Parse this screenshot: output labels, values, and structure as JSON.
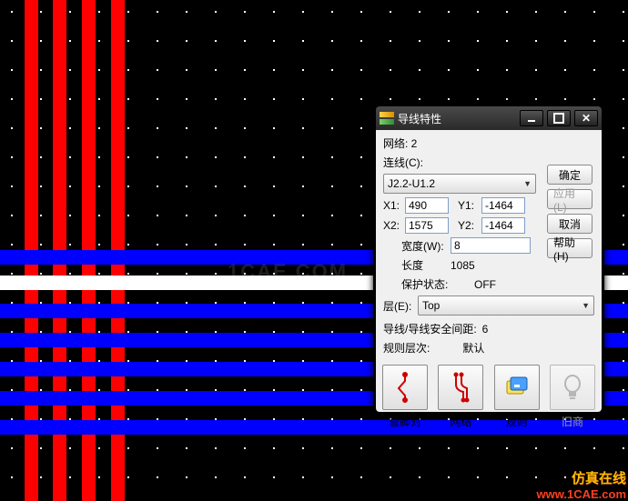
{
  "dialog": {
    "title": "导线特性",
    "net_label_line": "网络: 2",
    "conn_label": "连线(C):",
    "conn_value": "J2.2-U1.2",
    "x1_label": "X1:",
    "x1_value": "490",
    "y1_label": "Y1:",
    "y1_value": "-1464",
    "x2_label": "X2:",
    "x2_value": "1575",
    "y2_label": "Y2:",
    "y2_value": "-1464",
    "width_label": "宽度(W):",
    "width_value": "8",
    "length_label": "长度",
    "length_value": "1085",
    "protect_label": "保护状态:",
    "protect_value": "OFF",
    "layer_label": "层(E):",
    "layer_value": "Top",
    "clearance_label": "导线/导线安全间距:",
    "clearance_value": "6",
    "rlevel_label": "规则层次:",
    "rlevel_value": "默认",
    "icons": {
      "pinpair": "管脚对",
      "net": "网络",
      "rules": "规则",
      "show": "旧商"
    },
    "buttons": {
      "ok": "确定",
      "apply": "应用(L)",
      "cancel": "取消",
      "help": "帮助(H)"
    }
  },
  "watermark": {
    "main": "1CAE.COM",
    "badge_top": "仿真在线",
    "badge_bottom": "www.1CAE.com"
  }
}
